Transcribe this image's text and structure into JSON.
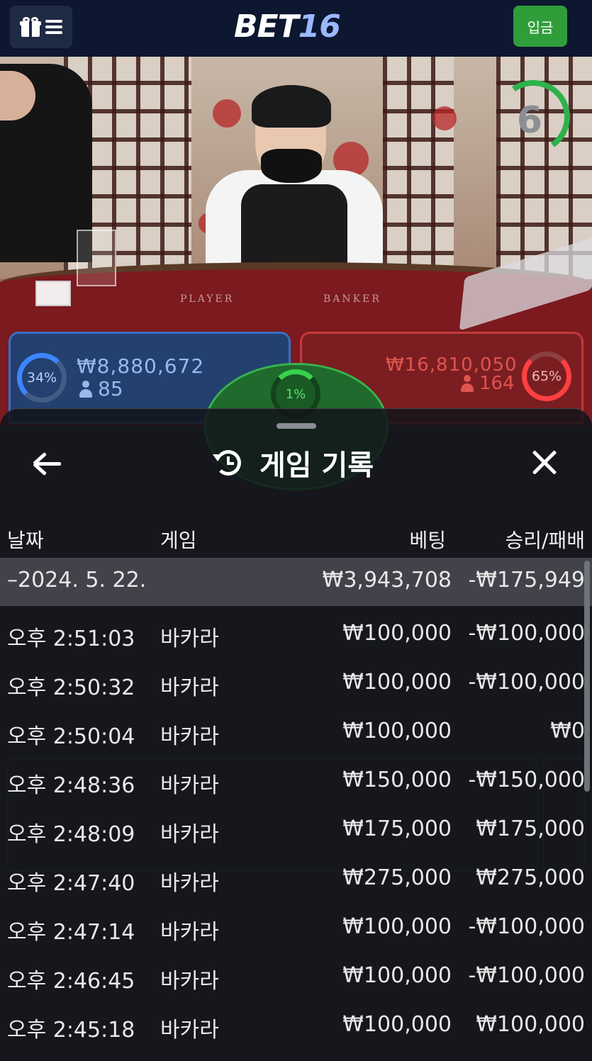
{
  "header": {
    "logo_part1": "BET",
    "logo_part2": "16",
    "deposit_label": "입금"
  },
  "game": {
    "timer": "6",
    "table_labels": {
      "player": "PLAYER",
      "banker": "BANKER"
    },
    "player": {
      "percent_label": "34%",
      "percent": 34,
      "amount": "₩8,880,672",
      "bettors": "85"
    },
    "banker": {
      "percent_label": "65%",
      "percent": 65,
      "amount": "₩16,810,050",
      "bettors": "164"
    },
    "tie": {
      "percent_label": "1%",
      "percent": 1
    }
  },
  "history": {
    "title": "게임 기록",
    "columns": {
      "date": "날짜",
      "game": "게임",
      "bet": "베팅",
      "win_loss": "승리/패배"
    },
    "summary": {
      "date": "–2024. 5. 22.",
      "bet": "₩3,943,708",
      "win_loss": "-₩175,949"
    },
    "rows": [
      {
        "time": "오후 2:51:03",
        "game": "바카라",
        "bet": "₩100,000",
        "win_loss": "-₩100,000"
      },
      {
        "time": "오후 2:50:32",
        "game": "바카라",
        "bet": "₩100,000",
        "win_loss": "-₩100,000"
      },
      {
        "time": "오후 2:50:04",
        "game": "바카라",
        "bet": "₩100,000",
        "win_loss": "₩0"
      },
      {
        "time": "오후 2:48:36",
        "game": "바카라",
        "bet": "₩150,000",
        "win_loss": "-₩150,000"
      },
      {
        "time": "오후 2:48:09",
        "game": "바카라",
        "bet": "₩175,000",
        "win_loss": "₩175,000"
      },
      {
        "time": "오후 2:47:40",
        "game": "바카라",
        "bet": "₩275,000",
        "win_loss": "₩275,000"
      },
      {
        "time": "오후 2:47:14",
        "game": "바카라",
        "bet": "₩100,000",
        "win_loss": "-₩100,000"
      },
      {
        "time": "오후 2:46:45",
        "game": "바카라",
        "bet": "₩100,000",
        "win_loss": "-₩100,000"
      },
      {
        "time": "오후 2:45:18",
        "game": "바카라",
        "bet": "₩100,000",
        "win_loss": "₩100,000"
      }
    ]
  },
  "colors": {
    "topbar": "#0d1730",
    "deposit": "#2f9e3a",
    "player": "#3b86ff",
    "banker": "#ff4040",
    "tie": "#37b24d"
  }
}
